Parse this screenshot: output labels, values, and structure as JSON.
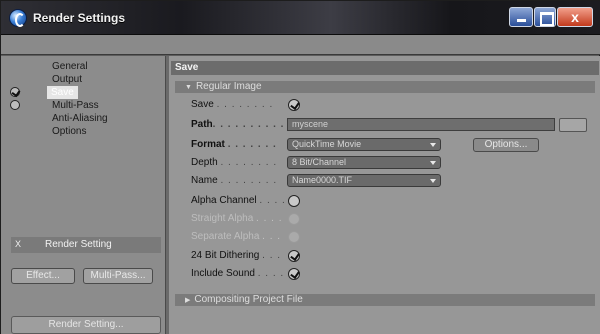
{
  "window": {
    "title": "Render Settings",
    "buttons": {
      "minimize": "",
      "maximize": "",
      "close": "x"
    }
  },
  "sidebar": {
    "items": [
      {
        "label": "General",
        "checked": false,
        "check": false
      },
      {
        "label": "Output",
        "checked": false,
        "check": false
      },
      {
        "label": "Save",
        "checked": true,
        "check": true
      },
      {
        "label": "Multi-Pass",
        "checked": false,
        "check": true
      },
      {
        "label": "Anti-Aliasing",
        "checked": false,
        "check": false
      },
      {
        "label": "Options",
        "checked": false,
        "check": false
      }
    ],
    "effect_button": "Effect...",
    "multipass_button": "Multi-Pass...",
    "setting_row": {
      "x_label": "X",
      "label": "Render Setting"
    },
    "bottom_button": "Render Setting..."
  },
  "main": {
    "section_title": "Save",
    "regular_image_header": "Regular Image",
    "compositing_header": "Compositing Project File",
    "rows": {
      "save": {
        "label": "Save",
        "checked": true
      },
      "path": {
        "label": "Path",
        "value": "myscene"
      },
      "format": {
        "label": "Format",
        "value": "QuickTime Movie",
        "options_button": "Options..."
      },
      "depth": {
        "label": "Depth",
        "value": "8 Bit/Channel"
      },
      "name": {
        "label": "Name",
        "value": "Name0000.TIF"
      },
      "alpha": {
        "label": "Alpha Channel",
        "checked": false
      },
      "straight_alpha": {
        "label": "Straight Alpha",
        "checked": false
      },
      "separate_alpha": {
        "label": "Separate Alpha",
        "checked": false
      },
      "dithering": {
        "label": "24 Bit Dithering",
        "checked": true
      },
      "sound": {
        "label": "Include Sound",
        "checked": true
      }
    }
  }
}
